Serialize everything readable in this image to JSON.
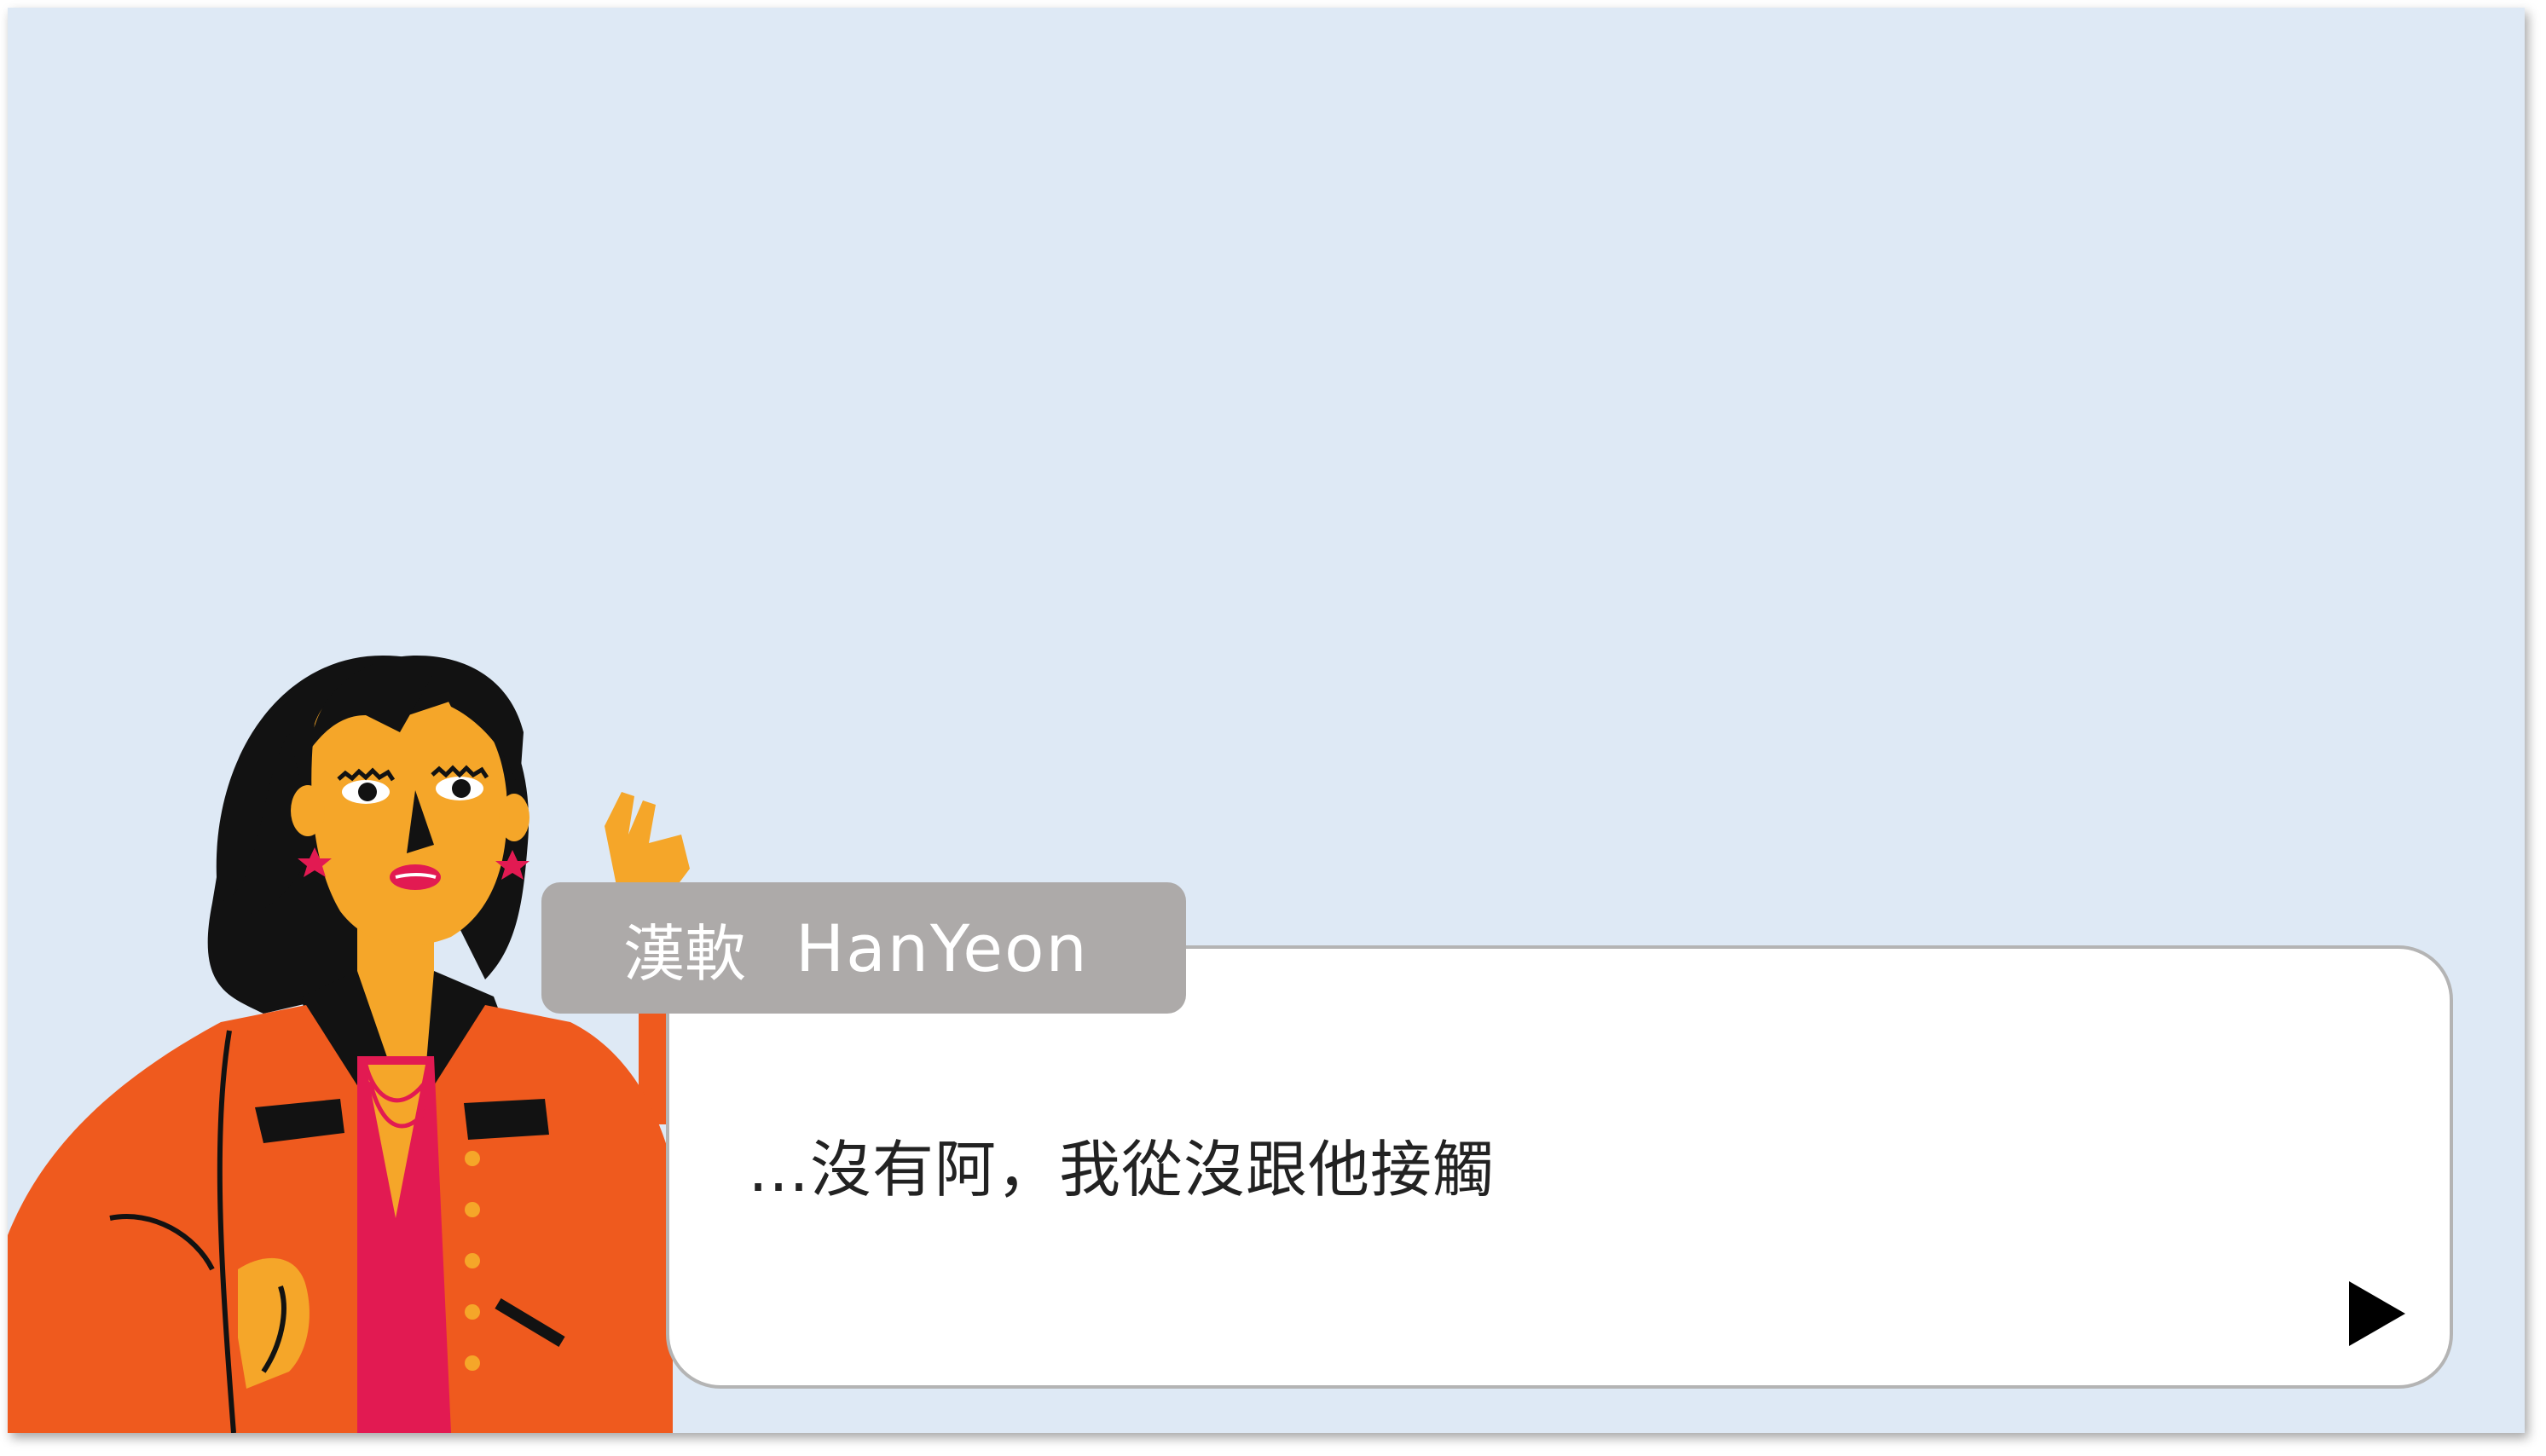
{
  "colors": {
    "background": "#dee9f5",
    "dialog_bg": "#ffffff",
    "dialog_border": "#b4b4b4",
    "nameplate_bg": "#adaaa9",
    "nameplate_text": "#ffffff",
    "dialog_text": "#222222",
    "jacket": "#ef5a1e",
    "skin": "#f5a629",
    "hair": "#121212",
    "shirt": "#e21a52"
  },
  "character": {
    "icon": "woman-character-portrait"
  },
  "speaker": {
    "name_cn": "漢軟",
    "name_en": "HanYeon"
  },
  "dialog": {
    "text": "…沒有阿，我從沒跟他接觸"
  },
  "advance": {
    "icon": "play-triangle-icon"
  }
}
